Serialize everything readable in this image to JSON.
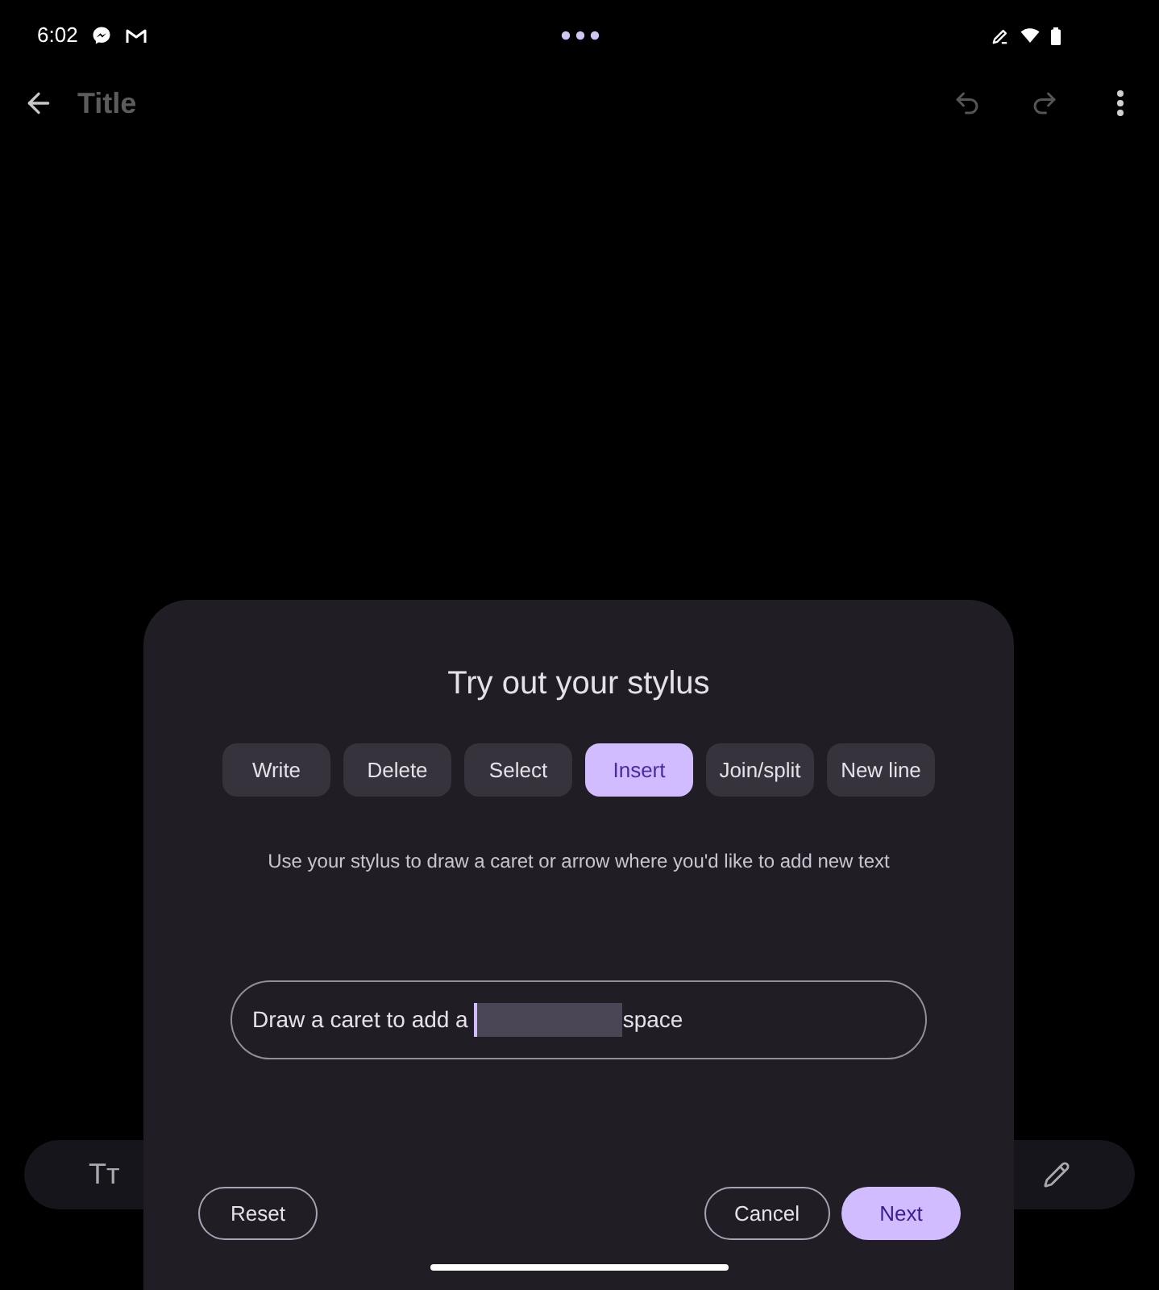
{
  "status_bar": {
    "time": "6:02"
  },
  "app_bar": {
    "title_placeholder": "Title",
    "undo_disabled": true,
    "redo_disabled": true
  },
  "toolbar": {
    "format_button": "Tт"
  },
  "sheet": {
    "title": "Try out your stylus",
    "tabs": [
      {
        "label": "Write",
        "selected": false
      },
      {
        "label": "Delete",
        "selected": false
      },
      {
        "label": "Select",
        "selected": false
      },
      {
        "label": "Insert",
        "selected": true
      },
      {
        "label": "Join/split",
        "selected": false
      },
      {
        "label": "New line",
        "selected": false
      }
    ],
    "instruction": "Use your stylus to draw a caret or arrow where you'd like to add new text",
    "practice_field": {
      "text_before": "Draw a caret to add a",
      "text_after": "space"
    },
    "buttons_left": [
      {
        "label": "Reset",
        "kind": "outlined"
      }
    ],
    "buttons_right": [
      {
        "label": "Cancel",
        "kind": "outlined"
      },
      {
        "label": "Next",
        "kind": "filled"
      }
    ]
  }
}
